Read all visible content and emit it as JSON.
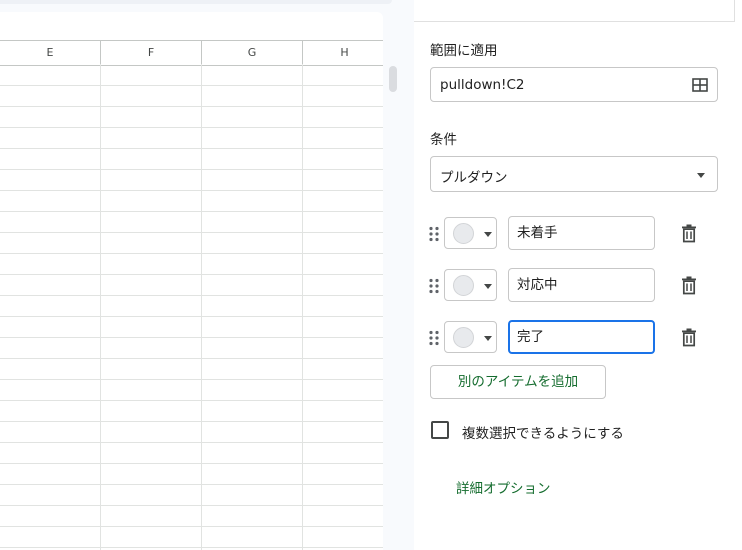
{
  "sheet": {
    "columns": [
      "E",
      "F",
      "G",
      "H"
    ],
    "row_count": 23
  },
  "panel": {
    "range_label": "範囲に適用",
    "range_value": "pulldown!C2",
    "condition_label": "条件",
    "condition_value": "プルダウン",
    "items": [
      {
        "value": "未着手",
        "color": "#e8eaed",
        "focused": false
      },
      {
        "value": "対応中",
        "color": "#e8eaed",
        "focused": false
      },
      {
        "value": "完了",
        "color": "#e8eaed",
        "focused": true
      }
    ],
    "add_item_label": "別のアイテムを追加",
    "multi_select_label": "複数選択できるようにする",
    "multi_select_checked": false,
    "advanced_options_label": "詳細オプション"
  },
  "colors": {
    "accent_green": "#146c2e",
    "focus_blue": "#1a73e8"
  }
}
